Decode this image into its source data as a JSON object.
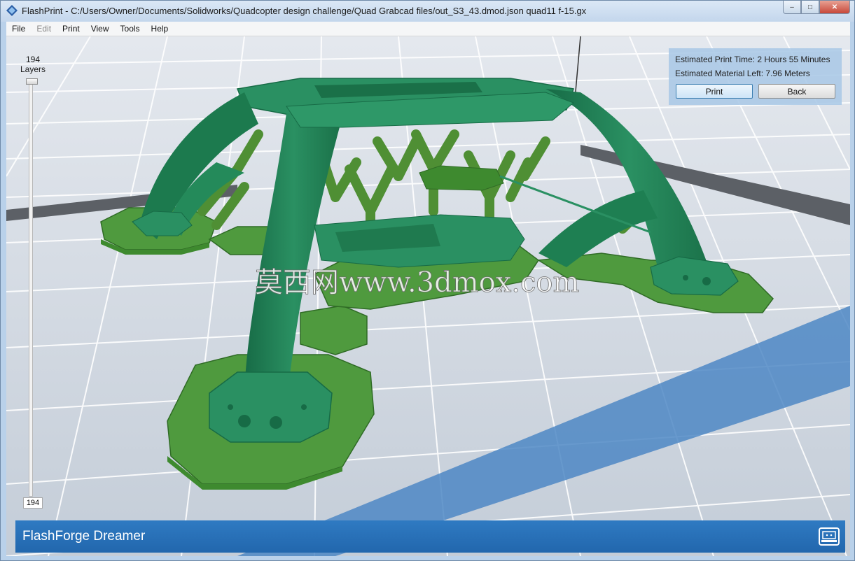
{
  "window": {
    "title": "FlashPrint - C:/Users/Owner/Documents/Solidworks/Quadcopter design challenge/Quad Grabcad files/out_S3_43.dmod.json quad11 f-15.gx",
    "app_icon": "flashprint-icon",
    "controls": {
      "minimize": "–",
      "maximize": "□",
      "close": "✕"
    }
  },
  "menu": {
    "items": [
      {
        "label": "File",
        "enabled": true
      },
      {
        "label": "Edit",
        "enabled": false
      },
      {
        "label": "Print",
        "enabled": true
      },
      {
        "label": "View",
        "enabled": true
      },
      {
        "label": "Tools",
        "enabled": true
      },
      {
        "label": "Help",
        "enabled": true
      }
    ]
  },
  "layer_slider": {
    "count": "194",
    "unit": "Layers",
    "current_value": "194",
    "level_fraction": 1.0
  },
  "info_panel": {
    "print_time_label": "Estimated Print Time:",
    "print_time_value": "2 Hours 55 Minutes",
    "material_label": "Estimated Material Left:",
    "material_value": "7.96 Meters",
    "print_button": "Print",
    "back_button": "Back"
  },
  "watermark": "莫西网www.3dmox.com",
  "status_bar": {
    "printer_name": "FlashForge Dreamer",
    "icon": "printer-icon"
  },
  "colors": {
    "model_dark": "#1e7a52",
    "model_mid": "#2a9062",
    "support_green": "#4a8f3a",
    "raft_green": "#4f9a3e",
    "status_blue": "#2a72b9",
    "platform_blue": "#4e87c4"
  }
}
